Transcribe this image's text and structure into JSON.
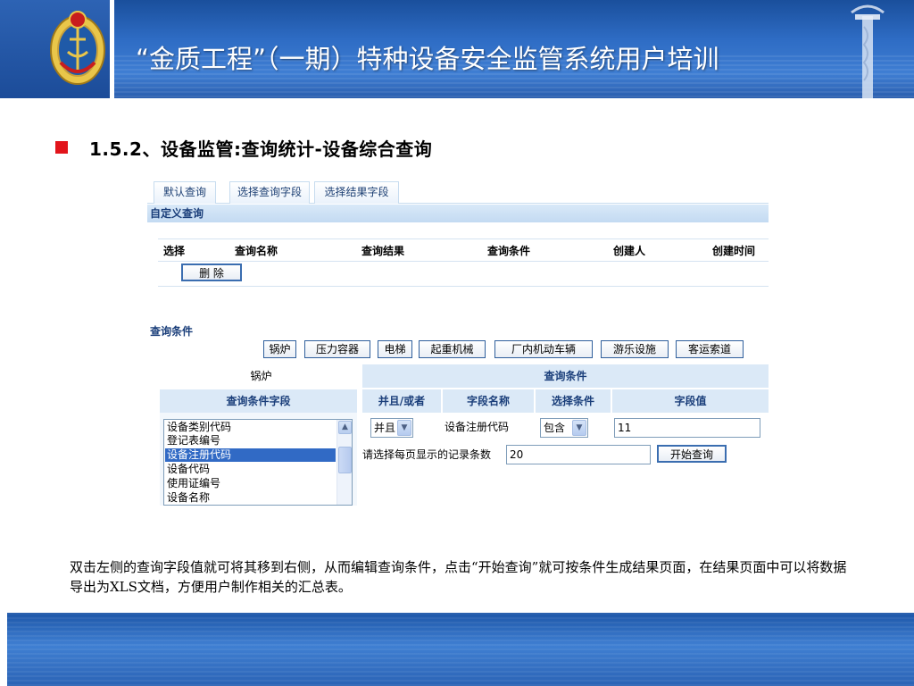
{
  "slide": {
    "title": "“金质工程”（一期）特种设备安全监管系统用户培训",
    "section": "1.5.2、设备监管:查询统计-设备综合查询",
    "description": "双击左侧的查询字段值就可将其移到右侧，从而编辑查询条件，点击“开始查询”就可按条件生成结果页面，在结果页面中可以将数据导出为XLS文档，方便用户制作相关的汇总表。"
  },
  "colors": {
    "header_blue": "#2e6cc4",
    "bullet_red": "#e2141b",
    "panel_blue": "#dbe9f7"
  },
  "app": {
    "tabs": [
      "默认查询",
      "选择查询字段",
      "选择结果字段"
    ],
    "custom_query": {
      "title": "自定义查询",
      "columns": [
        "选择",
        "查询名称",
        "查询结果",
        "查询条件",
        "创建人",
        "创建时间"
      ],
      "delete_label": "删 除"
    },
    "conditions": {
      "title": "查询条件",
      "categories": [
        "锅炉",
        "压力容器",
        "电梯",
        "起重机械",
        "厂内机动车辆",
        "游乐设施",
        "客运索道"
      ],
      "selected_category": "锅炉",
      "right_title": "查询条件",
      "left_head": "查询条件字段",
      "right_columns": [
        "并且/或者",
        "字段名称",
        "选择条件",
        "字段值"
      ],
      "fields": [
        "设备类别代码",
        "登记表编号",
        "设备注册代码",
        "设备代码",
        "使用证编号",
        "设备名称"
      ],
      "selected_field": "设备注册代码",
      "row": {
        "logic": "并且",
        "field_name": "设备注册代码",
        "operator": "包含",
        "value": "11"
      },
      "page_size_label": "请选择每页显示的记录条数",
      "page_size": "20",
      "start_label": "开始查询"
    }
  }
}
